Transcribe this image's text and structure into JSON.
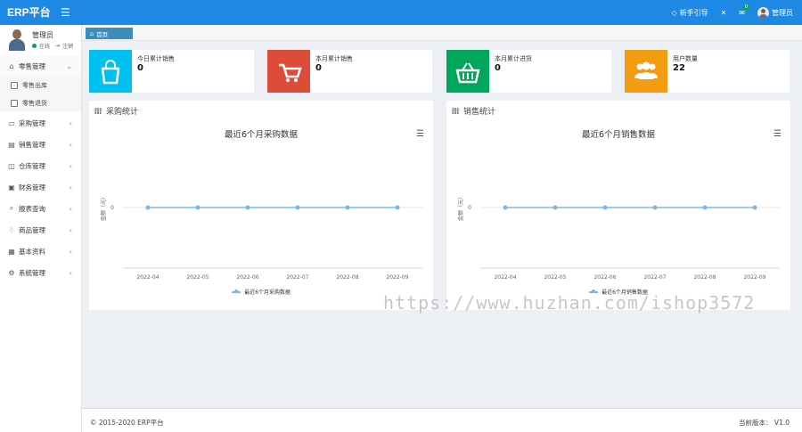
{
  "header": {
    "brand": "ERP平台",
    "guide_label": "新手引导",
    "mail_badge": "0",
    "user": "管理员"
  },
  "sidebar": {
    "user": {
      "name": "管理员",
      "status": "在线",
      "logout": "注销"
    },
    "menu": [
      {
        "label": "零售管理",
        "open": true,
        "children": [
          "零售出库",
          "零售退货"
        ]
      },
      {
        "label": "采购管理"
      },
      {
        "label": "销售管理"
      },
      {
        "label": "仓库管理"
      },
      {
        "label": "财务管理"
      },
      {
        "label": "报表查询"
      },
      {
        "label": "商品管理"
      },
      {
        "label": "基本资料"
      },
      {
        "label": "系统管理"
      }
    ]
  },
  "tabs": {
    "home": "首页"
  },
  "info_boxes": [
    {
      "label": "今日累计销售",
      "value": "0",
      "color": "#00c0ef",
      "icon": "shopping-bag-icon"
    },
    {
      "label": "本月累计销售",
      "value": "0",
      "color": "#dd4b39",
      "icon": "shopping-cart-icon"
    },
    {
      "label": "本月累计进货",
      "value": "0",
      "color": "#00a65a",
      "icon": "shopping-basket-icon"
    },
    {
      "label": "用户数量",
      "value": "22",
      "color": "#f39c12",
      "icon": "users-icon"
    }
  ],
  "panels": {
    "purchase_title": "采购统计",
    "sales_title": "销售统计"
  },
  "chart_data": [
    {
      "type": "line",
      "title": "最近6个月采购数据",
      "ylabel": "金额（元）",
      "categories": [
        "2022-04",
        "2022-05",
        "2022-06",
        "2022-07",
        "2022-08",
        "2022-09"
      ],
      "series": [
        {
          "name": "最近6个月采购数据",
          "values": [
            0,
            0,
            0,
            0,
            0,
            0
          ]
        }
      ],
      "yticks": [
        "0"
      ],
      "legend": "bottom",
      "color": "#7cb5ec"
    },
    {
      "type": "line",
      "title": "最近6个月销售数据",
      "ylabel": "金额（元）",
      "categories": [
        "2022-04",
        "2022-05",
        "2022-06",
        "2022-07",
        "2022-08",
        "2022-09"
      ],
      "series": [
        {
          "name": "最近6个月销售数据",
          "values": [
            0,
            0,
            0,
            0,
            0,
            0
          ]
        }
      ],
      "yticks": [
        "0"
      ],
      "legend": "bottom",
      "color": "#7cb5ec"
    }
  ],
  "watermark": "https://www.huzhan.com/ishop3572",
  "footer": {
    "copyright": "© 2015-2020 ERP平台",
    "version": "当前版本： V1.0"
  }
}
